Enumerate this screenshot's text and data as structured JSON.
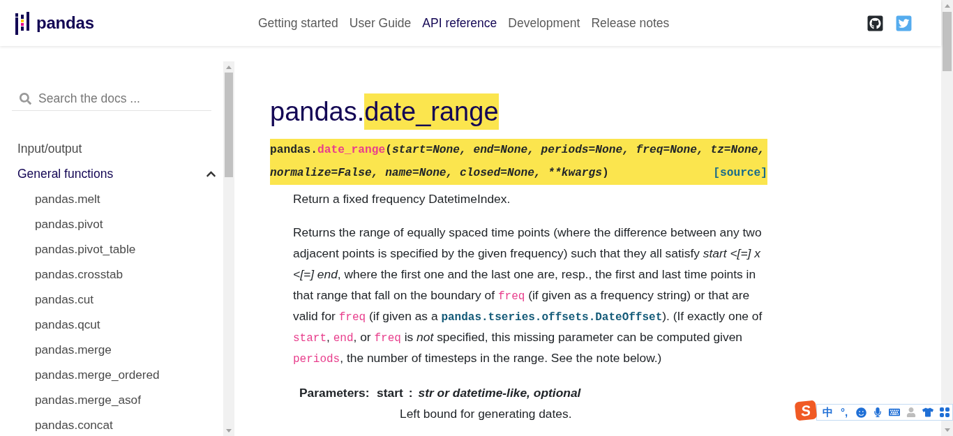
{
  "header": {
    "logo": {
      "name": "pandas"
    },
    "nav": [
      {
        "label": "Getting started",
        "selected": false
      },
      {
        "label": "User Guide",
        "selected": false
      },
      {
        "label": "API reference",
        "selected": true
      },
      {
        "label": "Development",
        "selected": false
      },
      {
        "label": "Release notes",
        "selected": false
      }
    ],
    "icon_links": [
      {
        "kind": "github"
      },
      {
        "kind": "twitter"
      }
    ]
  },
  "sidebar": {
    "search": {
      "placeholder": "Search the docs ..."
    },
    "items": [
      {
        "label": "Input/output",
        "selected": false
      },
      {
        "label": "General functions",
        "selected": true,
        "expanded": true,
        "children": [
          {
            "label": "pandas.melt",
            "selected": false
          },
          {
            "label": "pandas.pivot",
            "selected": false
          },
          {
            "label": "pandas.pivot_table",
            "selected": false
          },
          {
            "label": "pandas.crosstab",
            "selected": false
          },
          {
            "label": "pandas.cut",
            "selected": false
          },
          {
            "label": "pandas.qcut",
            "selected": false
          },
          {
            "label": "pandas.merge",
            "selected": false
          },
          {
            "label": "pandas.merge_ordered",
            "selected": false
          },
          {
            "label": "pandas.merge_asof",
            "selected": false
          },
          {
            "label": "pandas.concat",
            "selected": false
          }
        ]
      }
    ]
  },
  "content": {
    "title": [
      {
        "text": "pandas.",
        "highlighted": false
      },
      {
        "text": "date_range",
        "highlighted": true
      }
    ],
    "signature": {
      "highlighted": true,
      "parts": [
        {
          "kind": "prename",
          "text": "pandas."
        },
        {
          "kind": "name",
          "text": "date_range"
        },
        {
          "kind": "punct",
          "text": "("
        },
        {
          "kind": "params",
          "text": "start=None, end=None, periods=None, freq=None, tz=None, normalize=False, name=None, closed=None, **kwargs"
        },
        {
          "kind": "punct",
          "text": ")"
        }
      ],
      "source": "[source]"
    },
    "summary": "Return a fixed frequency DatetimeIndex.",
    "description": [
      {
        "kind": "text",
        "text": "Returns the range of equally spaced time points (where the difference between any two adjacent points is specified by the given frequency) such that they all satisfy "
      },
      {
        "kind": "em",
        "text": "start <[=] x <[=] end"
      },
      {
        "kind": "text",
        "text": ", where the first one and the last one are, resp., the first and last time points in that range that fall on the boundary of "
      },
      {
        "kind": "code",
        "text": "freq"
      },
      {
        "kind": "text",
        "text": " (if given as a frequency string) or that are valid for "
      },
      {
        "kind": "code",
        "text": "freq"
      },
      {
        "kind": "text",
        "text": " (if given as a "
      },
      {
        "kind": "link",
        "text": "pandas.tseries.offsets.DateOffset"
      },
      {
        "kind": "text",
        "text": "). (If exactly one of "
      },
      {
        "kind": "code",
        "text": "start"
      },
      {
        "kind": "text",
        "text": ", "
      },
      {
        "kind": "code",
        "text": "end"
      },
      {
        "kind": "text",
        "text": ", or "
      },
      {
        "kind": "code",
        "text": "freq"
      },
      {
        "kind": "text",
        "text": " is "
      },
      {
        "kind": "em",
        "text": "not"
      },
      {
        "kind": "text",
        "text": " specified, this missing parameter can be computed given "
      },
      {
        "kind": "code",
        "text": "periods"
      },
      {
        "kind": "text",
        "text": ", the number of timesteps in the range. See the note below.)"
      }
    ],
    "parameters": {
      "label": "Parameters:",
      "items": [
        {
          "name": "start",
          "separator": ":",
          "type": "str or datetime-like, optional",
          "description": "Left bound for generating dates."
        }
      ]
    }
  },
  "ime_toolbar": {
    "logo": "S",
    "mode": "中",
    "punctuation": "°,"
  }
}
